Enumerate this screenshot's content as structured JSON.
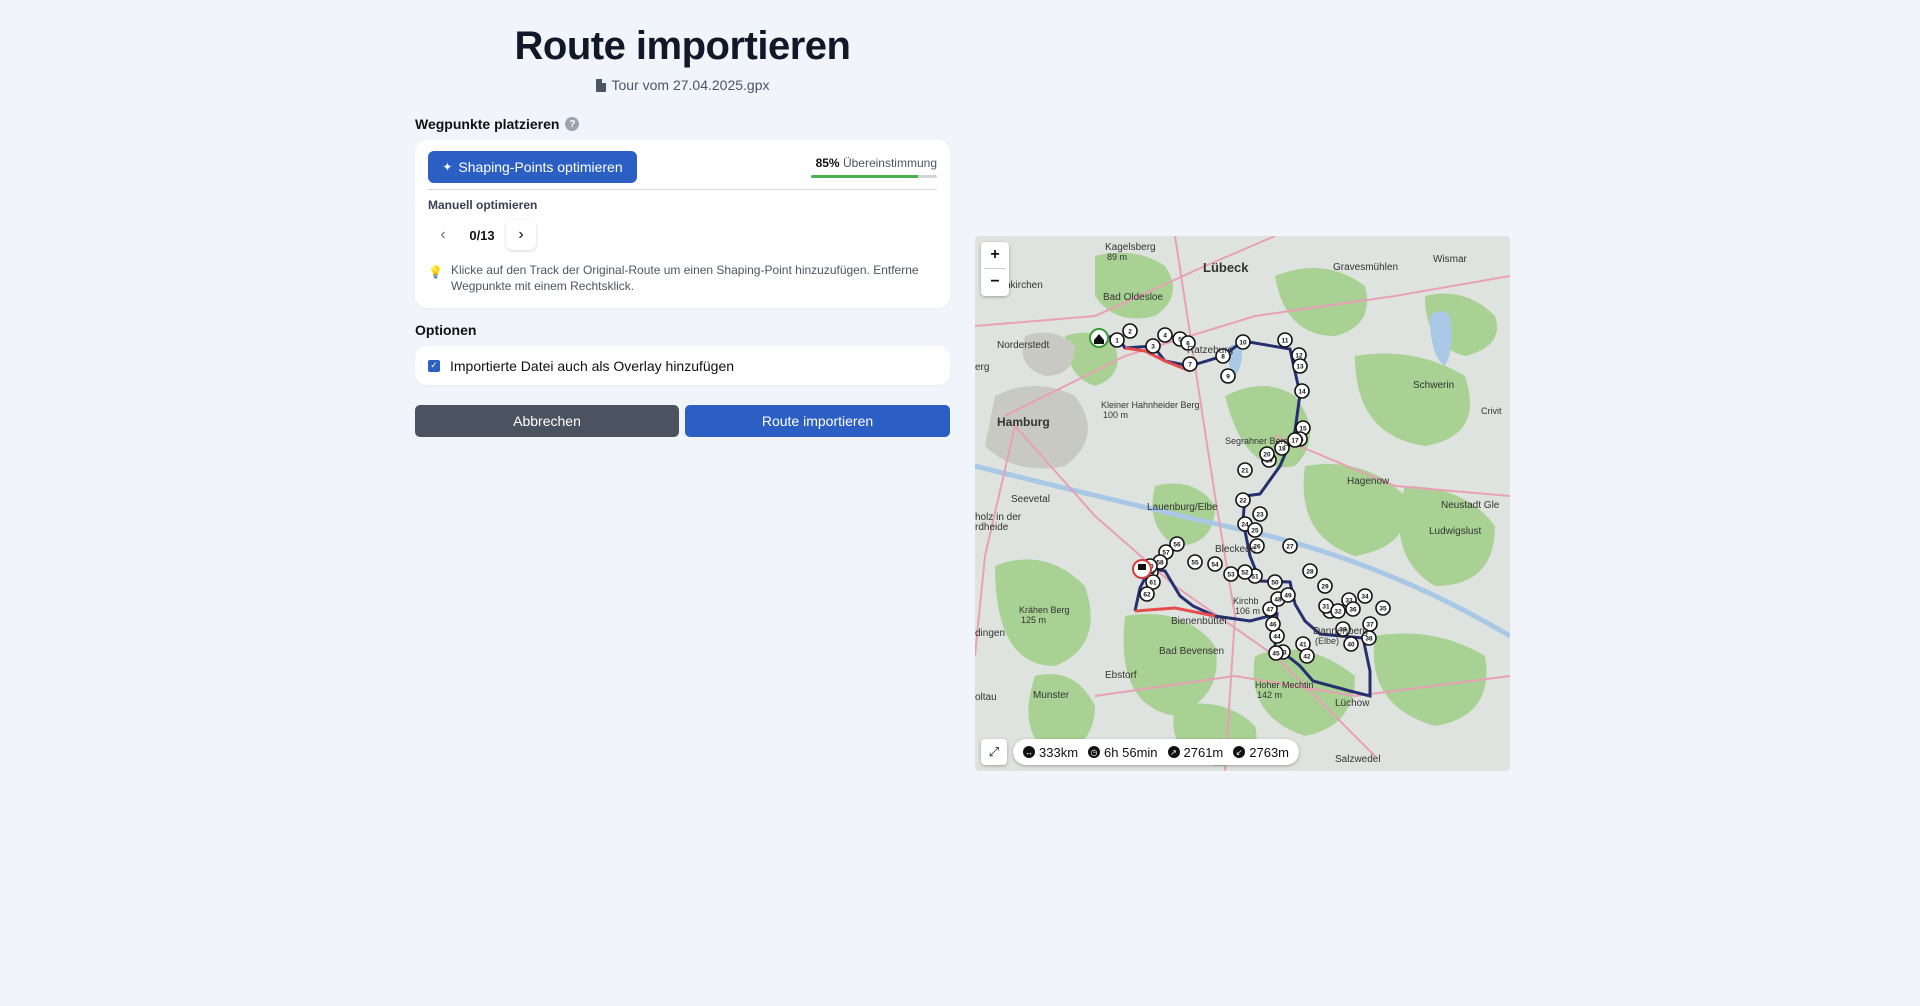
{
  "header": {
    "title": "Route importieren",
    "file_name": "Tour vom 27.04.2025.gpx",
    "file_icon": "file-icon"
  },
  "waypoints": {
    "label": "Wegpunkte platzieren",
    "help_icon": "?",
    "shaping_button": "Shaping-Points optimieren",
    "match_percent": "85%",
    "match_label": "Übereinstimmung",
    "match_fraction": 0.85,
    "manual_label": "Manuell optimieren",
    "stepper_value": "0/13",
    "hint": "Klicke auf den Track der Original-Route um einen Shaping-Point hinzuzufügen. Entferne Wegpunkte mit einem Rechtsklick."
  },
  "options": {
    "label": "Optionen",
    "overlay_checkbox_label": "Importierte Datei auch als Overlay hinzufügen",
    "overlay_checked": true
  },
  "actions": {
    "cancel_label": "Abbrechen",
    "import_label": "Route importieren"
  },
  "map": {
    "zoom_in": "+",
    "zoom_out": "−",
    "stats": {
      "distance": "333km",
      "duration": "6h 56min",
      "ascent": "2761m",
      "descent": "2763m"
    },
    "places": [
      {
        "name": "Kagelsberg",
        "sub": "89 m"
      },
      {
        "name": "Lübeck"
      },
      {
        "name": "Gravesmühlen"
      },
      {
        "name": "Wismar"
      },
      {
        "name": "nkirchen"
      },
      {
        "name": "Bad Oldesloe"
      },
      {
        "name": "Norderstedt"
      },
      {
        "name": "Ratzeburg"
      },
      {
        "name": "Schwerin"
      },
      {
        "name": "erg"
      },
      {
        "name": "Kleiner Hahnheider Berg",
        "sub": "100 m"
      },
      {
        "name": "Hamburg"
      },
      {
        "name": "Segrahner Berg"
      },
      {
        "name": "Crivit"
      },
      {
        "name": "Hagenow"
      },
      {
        "name": "Seevetal"
      },
      {
        "name": "Lauenburg/Elbe"
      },
      {
        "name": "Neustadt Gle"
      },
      {
        "name": "holz in der"
      },
      {
        "name": "rdheide"
      },
      {
        "name": "Ludwigslust"
      },
      {
        "name": "Bleckede"
      },
      {
        "name": "Krähen Berg",
        "sub": "125 m"
      },
      {
        "name": "Bienenbüttel"
      },
      {
        "name": "Kirchb",
        "sub": "106 m"
      },
      {
        "name": "Dannenberg",
        "sub": "(Elbe)"
      },
      {
        "name": "dingen"
      },
      {
        "name": "Bad Bevensen"
      },
      {
        "name": "Ebstorf"
      },
      {
        "name": "Hoher Mechtin",
        "sub": "142 m"
      },
      {
        "name": "Munster"
      },
      {
        "name": "Lüchow"
      },
      {
        "name": "oltau"
      },
      {
        "name": "Salzwedel"
      }
    ]
  }
}
